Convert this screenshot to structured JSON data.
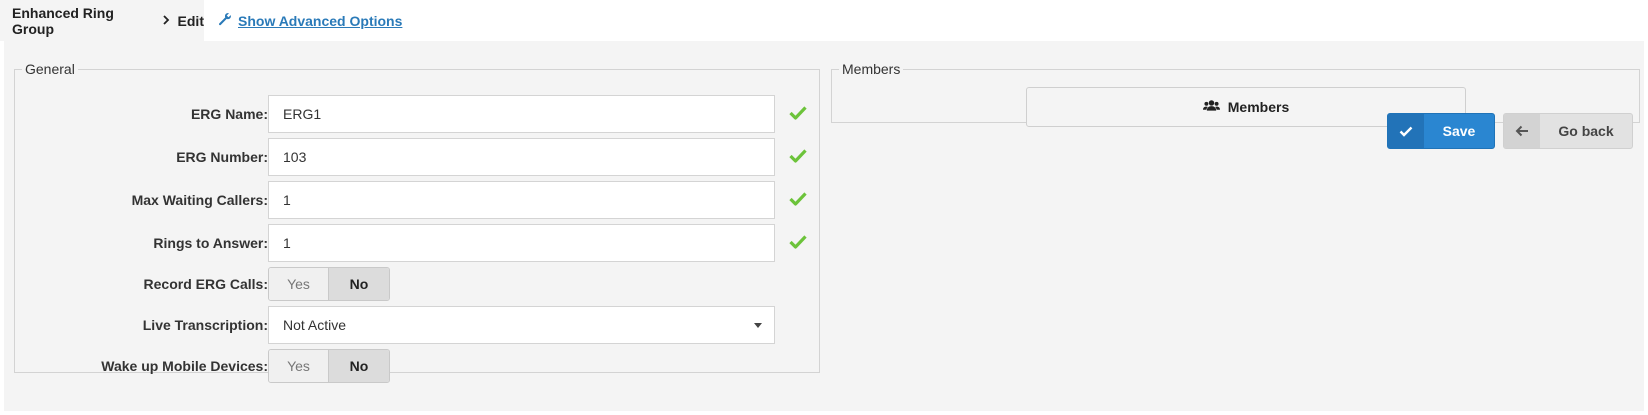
{
  "breadcrumb": {
    "parent": "Enhanced Ring Group",
    "current": "Edit"
  },
  "advanced_link": "Show Advanced Options",
  "general": {
    "legend": "General",
    "fields": [
      {
        "label": "ERG Name:",
        "value": "ERG1"
      },
      {
        "label": "ERG Number:",
        "value": "103"
      },
      {
        "label": "Max Waiting Callers:",
        "value": "1"
      },
      {
        "label": "Rings to Answer:",
        "value": "1"
      }
    ],
    "record_calls": {
      "label": "Record ERG Calls:",
      "yes": "Yes",
      "no": "No",
      "selected": "No"
    },
    "live_transcription": {
      "label": "Live Transcription:",
      "value": "Not Active"
    },
    "wake_mobile": {
      "label": "Wake up Mobile Devices:",
      "yes": "Yes",
      "no": "No",
      "selected": "No"
    }
  },
  "members": {
    "legend": "Members",
    "button_label": "Members"
  },
  "actions": {
    "save": "Save",
    "go_back": "Go back"
  },
  "colors": {
    "valid_check": "#6cc33a",
    "primary": "#2a86d1",
    "link": "#2a7ab8"
  }
}
